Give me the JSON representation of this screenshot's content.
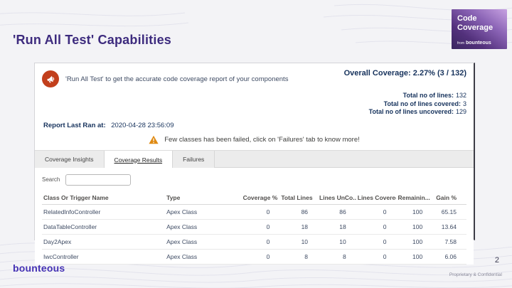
{
  "slide": {
    "title": "'Run All Test' Capabilities",
    "page_number": "2",
    "footer_note": "Proprietary & Confidential",
    "brand_logo": "bounteous"
  },
  "badge": {
    "title_line1": "Code",
    "title_line2": "Coverage",
    "from_label": "from",
    "brand": "bounteous"
  },
  "app": {
    "header": {
      "announcement_text": "'Run All Test' to get the accurate code coverage report of your components",
      "overall_coverage": "Overall Coverage: 2.27% (3 / 132)"
    },
    "totals": [
      {
        "label": "Total no of lines:",
        "value": "132"
      },
      {
        "label": "Total no of lines covered:",
        "value": "3"
      },
      {
        "label": "Total no of lines uncovered:",
        "value": "129"
      }
    ],
    "report_last_ran": {
      "label": "Report Last Ran at:",
      "value": "2020-04-28 23:56:09"
    },
    "warning_text": "Few classes has been failed, click on 'Failures' tab to know more!",
    "tabs": [
      {
        "label": "Coverage Insights",
        "active": false
      },
      {
        "label": "Coverage Results",
        "active": true
      },
      {
        "label": "Failures",
        "active": false
      }
    ],
    "search": {
      "label": "Search",
      "value": ""
    },
    "table": {
      "columns": [
        "Class Or Trigger Name",
        "Type",
        "Coverage %",
        "Total Lines",
        "Lines UnCo...",
        "Lines Covered",
        "Remainin...",
        "Gain %"
      ],
      "numeric_columns_from_index": 2,
      "rows": [
        [
          "RelatedInfoController",
          "Apex Class",
          "0",
          "86",
          "86",
          "0",
          "100",
          "65.15"
        ],
        [
          "DataTableController",
          "Apex Class",
          "0",
          "18",
          "18",
          "0",
          "100",
          "13.64"
        ],
        [
          "Day2Apex",
          "Apex Class",
          "0",
          "10",
          "10",
          "0",
          "100",
          "7.58"
        ],
        [
          "IwcController",
          "Apex Class",
          "0",
          "8",
          "8",
          "0",
          "100",
          "6.06"
        ]
      ]
    }
  },
  "colors": {
    "title_purple": "#3d2b7e",
    "brand_purple": "#4431b4",
    "badge_gradient_light": "#c7a2e2",
    "badge_gradient_dark": "#3a2560",
    "announce_icon_orange": "#c23f1c",
    "warning_amber": "#df8a13",
    "text_navy": "#16325c"
  }
}
